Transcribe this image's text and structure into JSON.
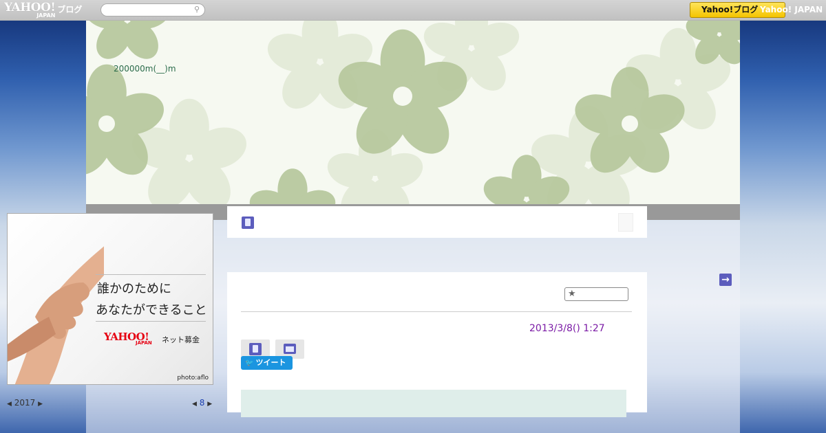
{
  "topbar": {
    "logo_word": "YAHOO!",
    "logo_sub": "JAPAN",
    "logo_blog": "ブログ",
    "search": {
      "placeholder": ""
    },
    "yahoo_button": "Yahoo!ブログ",
    "yahoo_link": "Yahoo! JAPAN"
  },
  "header": {
    "blog_title": "200000m(__)m"
  },
  "sidebar": {
    "banner": {
      "line1": "誰かのために",
      "line2": "あなたができること",
      "logo_word": "YAHOO!",
      "logo_sub": "JAPAN",
      "label": "ネット募金",
      "credit": "photo:aflo"
    },
    "calendar": {
      "year_prev": "◀",
      "year": "2017",
      "year_next": "▶",
      "month_prev": "◀",
      "month": "8",
      "month_next": "▶"
    }
  },
  "content": {
    "nav_prev": "←",
    "nav_next": "→",
    "article": {
      "date": "2013/3/8()  1:27",
      "tweet_label": "ツイート"
    }
  },
  "colors": {
    "accent": "#5c5dbd",
    "date": "#7a1aa5",
    "tweet": "#1b95e0",
    "yahoo_yellow": "#f4c400"
  }
}
